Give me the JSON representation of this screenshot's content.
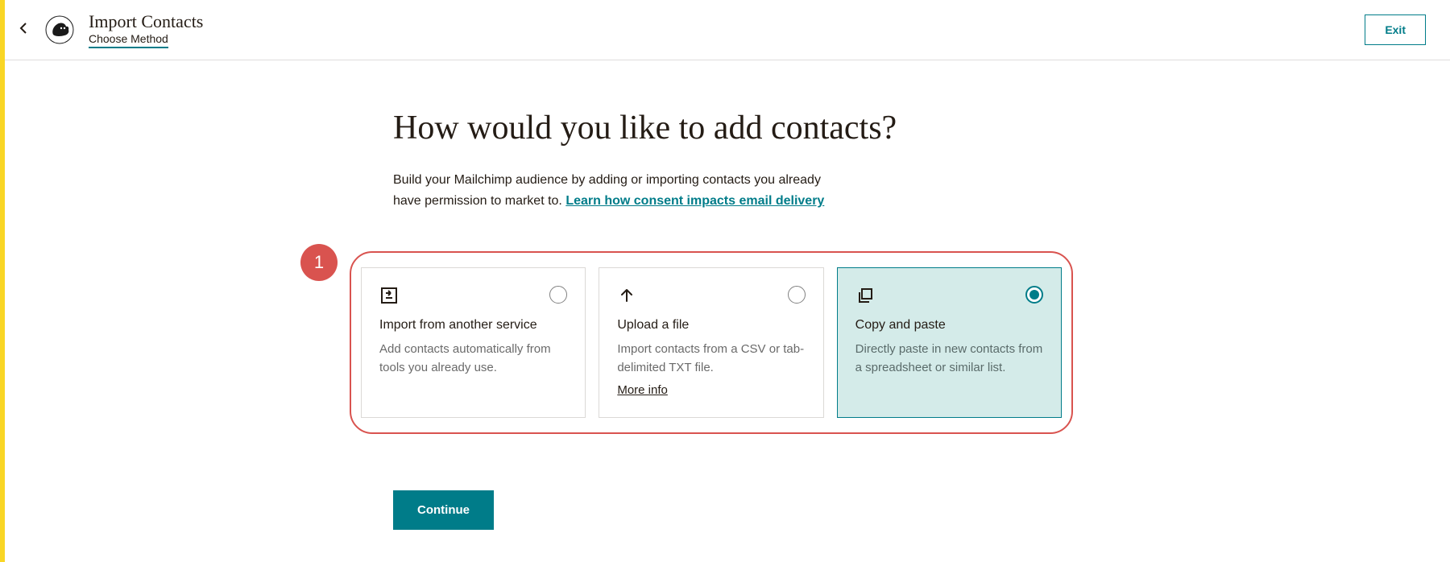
{
  "header": {
    "title": "Import Contacts",
    "subtitle": "Choose Method",
    "exit_label": "Exit"
  },
  "main": {
    "heading": "How would you like to add contacts?",
    "description_prefix": "Build your Mailchimp audience by adding or importing contacts you already have permission to market to. ",
    "consent_link_text": "Learn how consent impacts email delivery"
  },
  "annotation": {
    "badge": "1"
  },
  "options": [
    {
      "title": "Import from another service",
      "description": "Add contacts automatically from tools you already use.",
      "selected": false,
      "more_info": null,
      "icon": "import-icon"
    },
    {
      "title": "Upload a file",
      "description": "Import contacts from a CSV or tab-delimited TXT file.",
      "selected": false,
      "more_info": "More info",
      "icon": "upload-icon"
    },
    {
      "title": "Copy and paste",
      "description": "Directly paste in new contacts from a spreadsheet or similar list.",
      "selected": true,
      "more_info": null,
      "icon": "copy-icon"
    }
  ],
  "actions": {
    "continue_label": "Continue"
  }
}
